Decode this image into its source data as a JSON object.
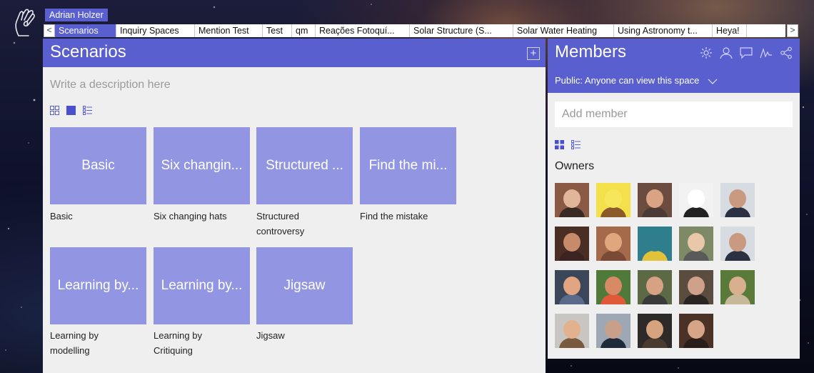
{
  "header": {
    "user_name": "Adrian Holzer",
    "tabs": [
      {
        "label": "Scenarios",
        "active": true
      },
      {
        "label": "Inquiry Spaces"
      },
      {
        "label": "Mention Test"
      },
      {
        "label": "Test"
      },
      {
        "label": "qm"
      },
      {
        "label": "Reações Fotoquí..."
      },
      {
        "label": "Solar Structure (S..."
      },
      {
        "label": "Solar Water Heating"
      },
      {
        "label": "Using Astronomy t..."
      },
      {
        "label": "Heya!"
      }
    ],
    "left_arrow": "<",
    "right_arrow": ">"
  },
  "scenarios": {
    "title": "Scenarios",
    "add_symbol": "+",
    "description_placeholder": "Write a description here",
    "cards": [
      {
        "tile": "Basic",
        "label": "Basic"
      },
      {
        "tile": "Six changin...",
        "label": "Six changing hats"
      },
      {
        "tile": "Structured ...",
        "label": "Structured controversy"
      },
      {
        "tile": "Find the mi...",
        "label": "Find the mistake"
      },
      {
        "tile": "Learning by...",
        "label": "Learning by modelling"
      },
      {
        "tile": "Learning by...",
        "label": "Learning by Critiquing"
      },
      {
        "tile": "Jigsaw",
        "label": "Jigsaw"
      }
    ]
  },
  "members": {
    "title": "Members",
    "visibility": "Public: Anyone can view this space",
    "add_member_placeholder": "Add member",
    "owners_title": "Owners",
    "icons": [
      "gear-icon",
      "person-icon",
      "chat-icon",
      "activity-icon",
      "share-icon"
    ],
    "avatars": [
      {
        "bg": "#8a5a44",
        "face": "#e2b69a",
        "body": "#3a2a24"
      },
      {
        "bg": "#f4e04a",
        "face": "#f6e65c",
        "body": "#8a5a2a"
      },
      {
        "bg": "#6b4c3e",
        "face": "#d9a384",
        "body": "#4b3a36"
      },
      {
        "bg": "#f2f2f2",
        "face": "#ffffff",
        "body": "#222222"
      },
      {
        "bg": "#d7dbe2",
        "face": "#c99a80",
        "body": "#2b3142"
      },
      {
        "bg": "#4a2e24",
        "face": "#c78a6a",
        "body": "#3a2320"
      },
      {
        "bg": "#a46a4a",
        "face": "#e0a77f",
        "body": "#7a4a36"
      },
      {
        "bg": "#2f7e8e",
        "face": "#2f7e8e",
        "body": "#e2c23a"
      },
      {
        "bg": "#7e8a66",
        "face": "#e8c8a8",
        "body": "#5a5a5a"
      },
      {
        "bg": "#d7dbe2",
        "face": "#c99a80",
        "body": "#2b3142"
      },
      {
        "bg": "#3b4658",
        "face": "#e1a582",
        "body": "#5a6a8a"
      },
      {
        "bg": "#4f7a3a",
        "face": "#d88a66",
        "body": "#e05a3a"
      },
      {
        "bg": "#5b6a44",
        "face": "#d6a283",
        "body": "#3a3a3a"
      },
      {
        "bg": "#5a4c3e",
        "face": "#cfa08a",
        "body": "#2a2422"
      },
      {
        "bg": "#5a7a3a",
        "face": "#d8b090",
        "body": "#c8b89a"
      },
      {
        "bg": "#c8c6c2",
        "face": "#e2b28f",
        "body": "#7a5a3e"
      },
      {
        "bg": "#9ea7b4",
        "face": "#c8a08a",
        "body": "#1f2a3a"
      },
      {
        "bg": "#2e2a2a",
        "face": "#d6a37f",
        "body": "#4a3a30"
      },
      {
        "bg": "#4a3326",
        "face": "#d6a588",
        "body": "#2a1e1a"
      }
    ]
  }
}
